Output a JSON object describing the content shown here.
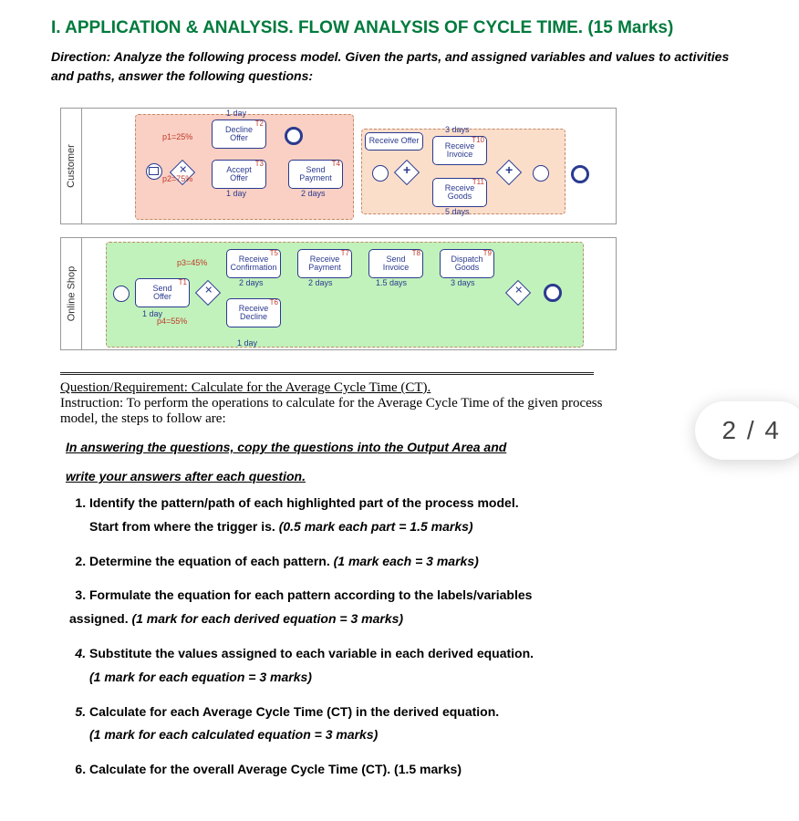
{
  "title": "I.  APPLICATION & ANALYSIS. FLOW ANALYSIS OF CYCLE TIME. (15 Marks)",
  "direction_lead": "Direction:  ",
  "direction_body": "Analyze the following process model. Given the parts, and assigned variables and values to activities and paths, answer the following questions:",
  "page_badge": "2 / 4",
  "diagram": {
    "lanes": {
      "customer": "Customer",
      "shop": "Online Shop"
    },
    "probs": {
      "p1": "p1=25%",
      "p2": "p2=75%",
      "p3": "p3=45%",
      "p4": "p4=55%"
    },
    "tasks": {
      "decline_offer": {
        "label1": "Decline",
        "label2": "Offer",
        "tid": "T2",
        "dur": "1 day"
      },
      "accept_offer": {
        "label1": "Accept",
        "label2": "Offer",
        "tid": "T3",
        "dur": "1 day"
      },
      "send_payment": {
        "label1": "Send",
        "label2": "Payment",
        "tid": "T4",
        "dur": "2 days"
      },
      "receive_offer_c": {
        "label1": "Receive Offer",
        "label2": "",
        "tid": "",
        "dur": ""
      },
      "receive_invoice": {
        "label1": "Receive",
        "label2": "Invoice",
        "tid": "T10",
        "dur": "3 days"
      },
      "receive_goods": {
        "label1": "Receive",
        "label2": "Goods",
        "tid": "T11",
        "dur": "5 days"
      },
      "send_offer": {
        "label1": "Send",
        "label2": "Offer",
        "tid": "T1",
        "dur": "1 day"
      },
      "recv_conf": {
        "label1": "Receive",
        "label2": "Confirmation",
        "tid": "T5",
        "dur": "2 days"
      },
      "recv_decline": {
        "label1": "Receive",
        "label2": "Decline",
        "tid": "T6",
        "dur": "1 day"
      },
      "recv_payment": {
        "label1": "Receive",
        "label2": "Payment",
        "tid": "T7",
        "dur": "2 days"
      },
      "send_invoice": {
        "label1": "Send",
        "label2": "Invoice",
        "tid": "T8",
        "dur": "1.5 days"
      },
      "dispatch_goods": {
        "label1": "Dispatch",
        "label2": "Goods",
        "tid": "T9",
        "dur": "3 days"
      }
    }
  },
  "qreq_label": "Question/Requirement:  ",
  "qreq_title": "Calculate for the Average Cycle Time (CT).",
  "qreq_instr": "Instruction:  To perform the operations to calculate for the Average Cycle Time of the given process model, the steps to follow are:",
  "note_line1": "In answering the questions, copy the questions into the Output Area and ",
  "note_line2": "write your answers after each question.",
  "questions": {
    "q1a": "Identify the pattern/path of each highlighted part of the process model.",
    "q1b": "Start from where the trigger is. ",
    "q1b_em": "(0.5 mark each part = 1.5 marks)",
    "q2": "Determine the equation of each pattern. ",
    "q2_em": "(1 mark each = 3 marks)",
    "q3a": "Formulate the equation for each pattern according to the labels/variables",
    "q3b": "assigned. ",
    "q3b_em": "(1 mark for each derived equation = 3 marks)",
    "q4a": "Substitute the values assigned to each variable in each derived equation.",
    "q4b_em": "(1 mark for each equation = 3 marks)",
    "q5a": "Calculate for each Average Cycle Time (CT) in the derived equation.",
    "q5b_em": "(1 mark for each calculated equation = 3 marks)",
    "q6": "Calculate for the overall Average Cycle Time (CT). ",
    "q6_em": "(1.5 marks)"
  }
}
